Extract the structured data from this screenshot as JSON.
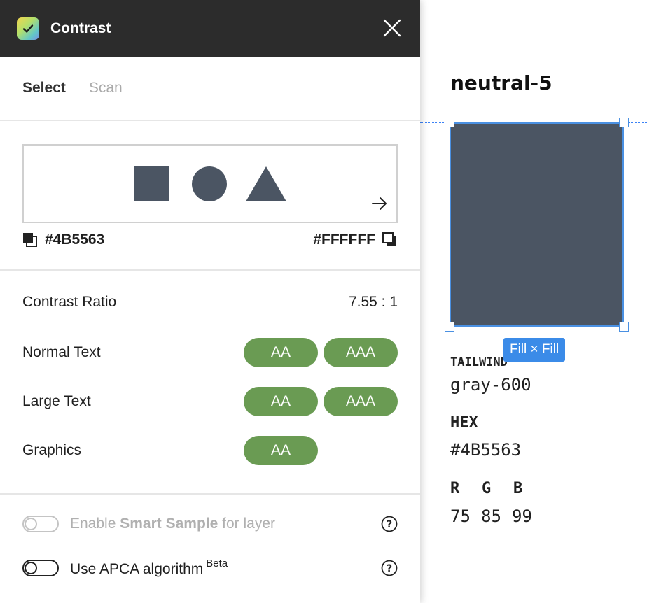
{
  "plugin": {
    "title": "Contrast",
    "icon": "check-app-icon",
    "close_icon": "close-icon",
    "tabs": [
      {
        "label": "Select",
        "active": true
      },
      {
        "label": "Scan",
        "active": false
      }
    ],
    "foreground_hex": "#4B5563",
    "background_hex": "#FFFFFF",
    "preview_shapes": [
      "square",
      "circle",
      "triangle"
    ],
    "ratio_label": "Contrast Ratio",
    "ratio_value": "7.55 : 1",
    "results": [
      {
        "label": "Normal Text",
        "badges": [
          "AA",
          "AAA"
        ]
      },
      {
        "label": "Large Text",
        "badges": [
          "AA",
          "AAA"
        ]
      },
      {
        "label": "Graphics",
        "badges": [
          "AA"
        ]
      }
    ],
    "smart_sample": {
      "prefix": "Enable ",
      "emphasis": "Smart Sample",
      "suffix": " for layer",
      "enabled": false,
      "disabled": true
    },
    "apca": {
      "label": "Use APCA algorithm",
      "beta": "Beta",
      "enabled": false
    }
  },
  "canvas": {
    "layer_name": "neutral-5",
    "swatch_color": "#4B5563",
    "fill_tag": "Fill × Fill",
    "tailwind_label": "TAILWIND",
    "tailwind_value": "gray-600",
    "hex_label": "HEX",
    "hex_value": "#4B5563",
    "rgb_labels": [
      "R",
      "G",
      "B"
    ],
    "rgb_values": [
      "75",
      "85",
      "99"
    ]
  },
  "colors": {
    "titlebar": "#2c2c2c",
    "pass_badge": "#6a9b53",
    "selection": "#4a90e2"
  }
}
